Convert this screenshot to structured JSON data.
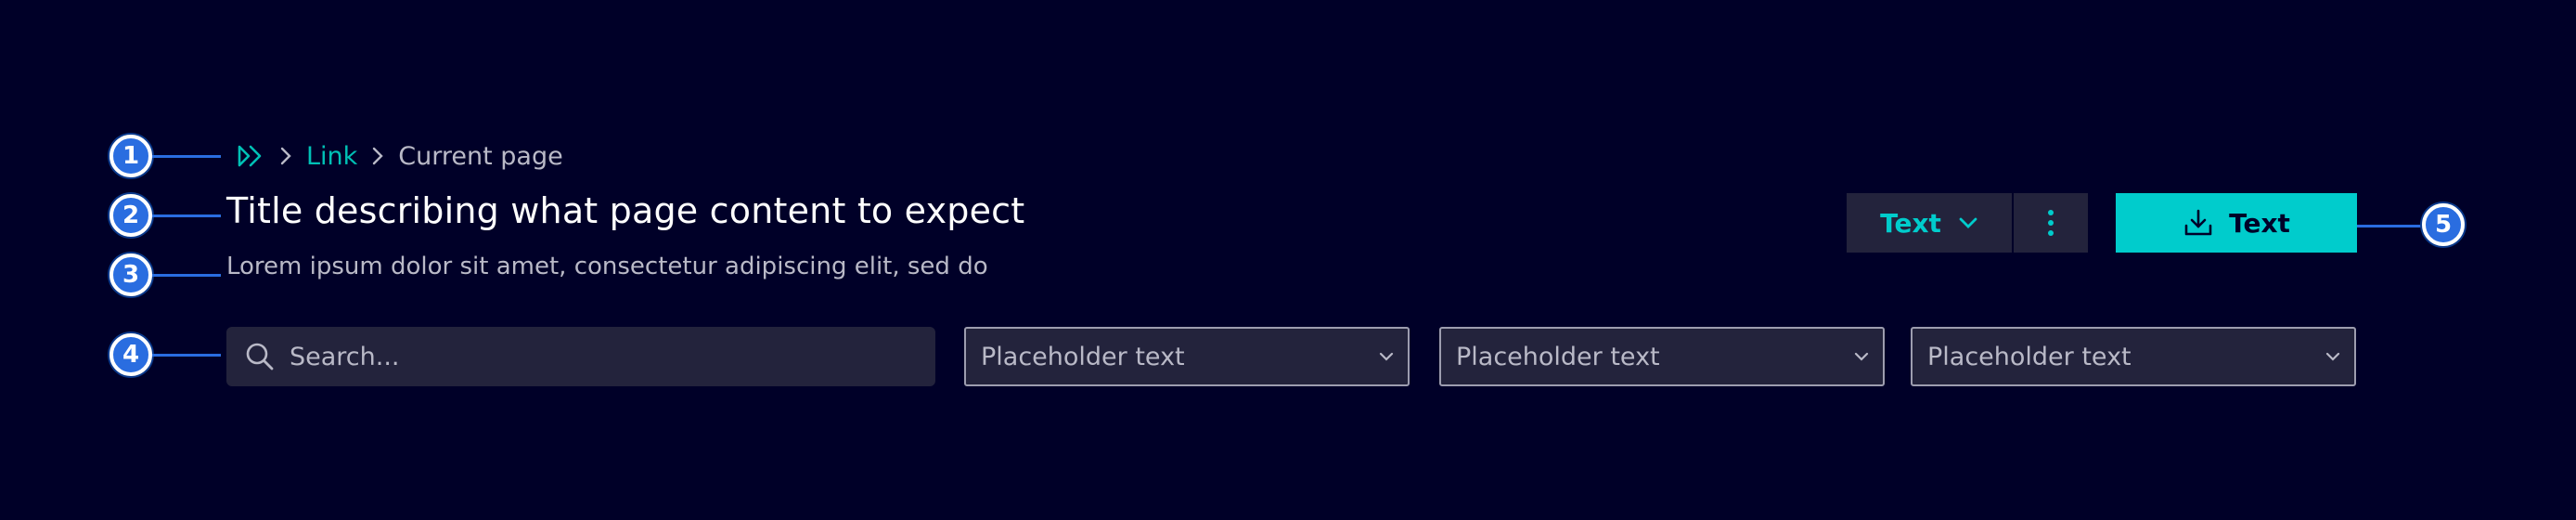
{
  "annotations": [
    "1",
    "2",
    "3",
    "4",
    "5"
  ],
  "breadcrumb": {
    "home_icon": "double-chevron-right-icon",
    "link_label": "Link",
    "current_label": "Current page"
  },
  "header": {
    "title": "Title describing what page content to expect",
    "subtitle": "Lorem ipsum dolor sit amet, consectetur adipiscing elit, sed do"
  },
  "actions": {
    "dropdown_label": "Text",
    "more_icon": "kebab-menu-icon",
    "primary_label": "Text",
    "primary_icon": "download-icon"
  },
  "filters": {
    "search_placeholder": "Search...",
    "selects": [
      {
        "placeholder": "Placeholder text"
      },
      {
        "placeholder": "Placeholder text"
      },
      {
        "placeholder": "Placeholder text"
      }
    ]
  },
  "colors": {
    "background": "#000028",
    "accent": "#00cccc",
    "surface": "#23233c",
    "marker": "#2a6de0"
  }
}
